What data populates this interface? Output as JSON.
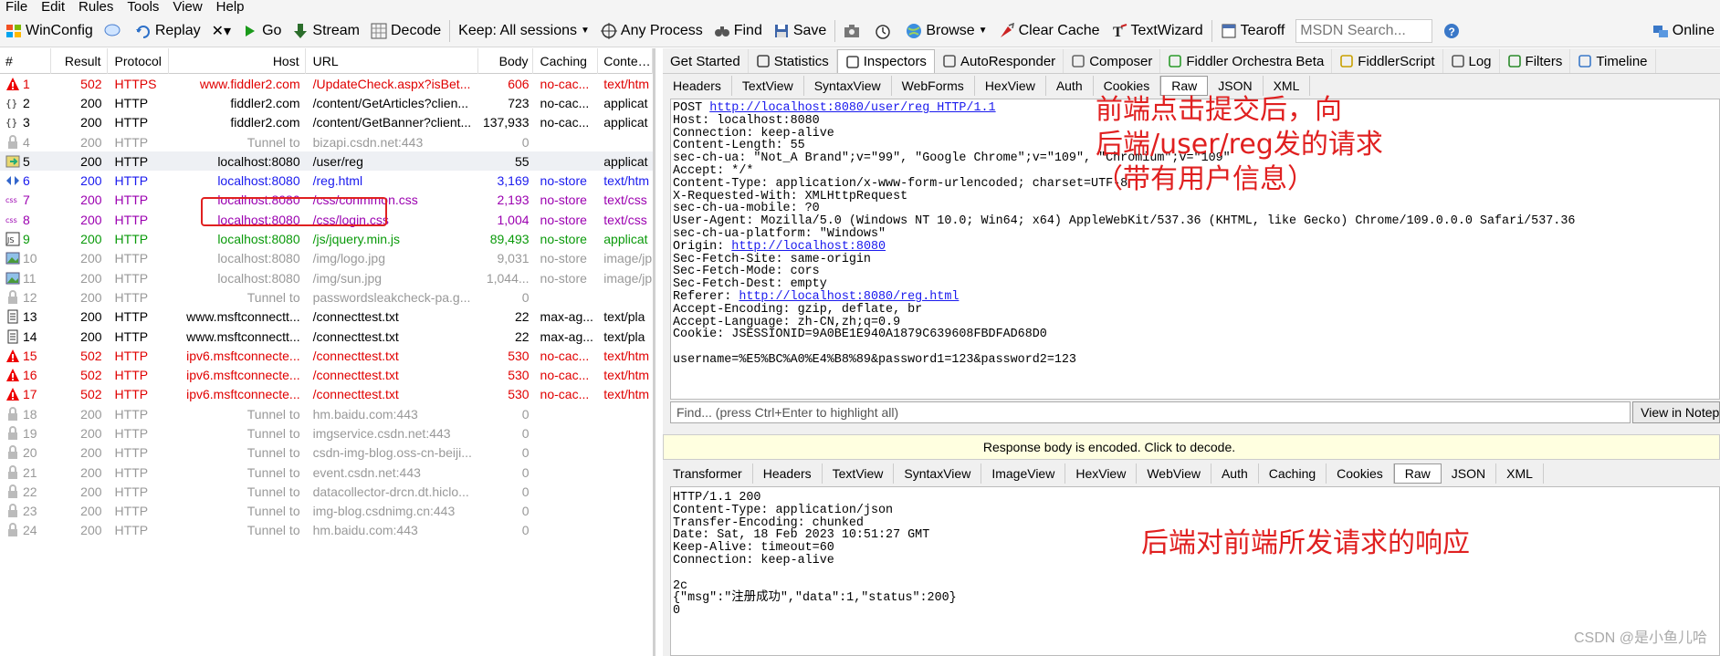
{
  "menu": [
    "File",
    "Edit",
    "Rules",
    "Tools",
    "View",
    "Help"
  ],
  "toolbar": {
    "winconfig": "WinConfig",
    "replay": "Replay",
    "remove": "✕▾",
    "go": "Go",
    "stream": "Stream",
    "decode": "Decode",
    "keep": "Keep: All sessions",
    "any_process": "Any Process",
    "find": "Find",
    "save": "Save",
    "browse": "Browse",
    "clear_cache": "Clear Cache",
    "textwizard": "TextWizard",
    "tearoff": "Tearoff",
    "msdn_placeholder": "MSDN Search...",
    "online": "Online"
  },
  "sessions": {
    "headers": [
      "#",
      "Result",
      "Protocol",
      "Host",
      "URL",
      "Body",
      "Caching",
      "Content-Type"
    ],
    "rows": [
      {
        "num": "1",
        "result": "502",
        "protocol": "HTTPS",
        "host": "www.fiddler2.com",
        "url": "/UpdateCheck.aspx?isBet...",
        "body": "606",
        "caching": "no-cac...",
        "ctype": "text/htm",
        "style": "red",
        "icon": "warn"
      },
      {
        "num": "2",
        "result": "200",
        "protocol": "HTTP",
        "host": "fiddler2.com",
        "url": "/content/GetArticles?clien...",
        "body": "723",
        "caching": "no-cac...",
        "ctype": "applicat",
        "style": "black",
        "icon": "json"
      },
      {
        "num": "3",
        "result": "200",
        "protocol": "HTTP",
        "host": "fiddler2.com",
        "url": "/content/GetBanner?client...",
        "body": "137,933",
        "caching": "no-cac...",
        "ctype": "applicat",
        "style": "black",
        "icon": "json"
      },
      {
        "num": "4",
        "result": "200",
        "protocol": "HTTP",
        "host": "Tunnel to",
        "url": "bizapi.csdn.net:443",
        "body": "0",
        "caching": "",
        "ctype": "",
        "style": "gray",
        "icon": "lock"
      },
      {
        "num": "5",
        "result": "200",
        "protocol": "HTTP",
        "host": "localhost:8080",
        "url": "/user/reg",
        "body": "55",
        "caching": "",
        "ctype": "applicat",
        "style": "black",
        "icon": "sel",
        "selected": true
      },
      {
        "num": "6",
        "result": "200",
        "protocol": "HTTP",
        "host": "localhost:8080",
        "url": "/reg.html",
        "body": "3,169",
        "caching": "no-store",
        "ctype": "text/htm",
        "style": "blue",
        "icon": "html"
      },
      {
        "num": "7",
        "result": "200",
        "protocol": "HTTP",
        "host": "localhost:8080",
        "url": "/css/conmmon.css",
        "body": "2,193",
        "caching": "no-store",
        "ctype": "text/css",
        "style": "purple",
        "icon": "css"
      },
      {
        "num": "8",
        "result": "200",
        "protocol": "HTTP",
        "host": "localhost:8080",
        "url": "/css/login.css",
        "body": "1,004",
        "caching": "no-store",
        "ctype": "text/css",
        "style": "purple",
        "icon": "css"
      },
      {
        "num": "9",
        "result": "200",
        "protocol": "HTTP",
        "host": "localhost:8080",
        "url": "/js/jquery.min.js",
        "body": "89,493",
        "caching": "no-store",
        "ctype": "applicat",
        "style": "green",
        "icon": "js"
      },
      {
        "num": "10",
        "result": "200",
        "protocol": "HTTP",
        "host": "localhost:8080",
        "url": "/img/logo.jpg",
        "body": "9,031",
        "caching": "no-store",
        "ctype": "image/jp",
        "style": "gray",
        "icon": "img"
      },
      {
        "num": "11",
        "result": "200",
        "protocol": "HTTP",
        "host": "localhost:8080",
        "url": "/img/sun.jpg",
        "body": "1,044...",
        "caching": "no-store",
        "ctype": "image/jp",
        "style": "gray",
        "icon": "img"
      },
      {
        "num": "12",
        "result": "200",
        "protocol": "HTTP",
        "host": "Tunnel to",
        "url": "passwordsleakcheck-pa.g...",
        "body": "0",
        "caching": "",
        "ctype": "",
        "style": "gray",
        "icon": "lock"
      },
      {
        "num": "13",
        "result": "200",
        "protocol": "HTTP",
        "host": "www.msftconnectt...",
        "url": "/connecttest.txt",
        "body": "22",
        "caching": "max-ag...",
        "ctype": "text/pla",
        "style": "black",
        "icon": "doc"
      },
      {
        "num": "14",
        "result": "200",
        "protocol": "HTTP",
        "host": "www.msftconnectt...",
        "url": "/connecttest.txt",
        "body": "22",
        "caching": "max-ag...",
        "ctype": "text/pla",
        "style": "black",
        "icon": "doc"
      },
      {
        "num": "15",
        "result": "502",
        "protocol": "HTTP",
        "host": "ipv6.msftconnecte...",
        "url": "/connecttest.txt",
        "body": "530",
        "caching": "no-cac...",
        "ctype": "text/htm",
        "style": "red",
        "icon": "warn"
      },
      {
        "num": "16",
        "result": "502",
        "protocol": "HTTP",
        "host": "ipv6.msftconnecte...",
        "url": "/connecttest.txt",
        "body": "530",
        "caching": "no-cac...",
        "ctype": "text/htm",
        "style": "red",
        "icon": "warn"
      },
      {
        "num": "17",
        "result": "502",
        "protocol": "HTTP",
        "host": "ipv6.msftconnecte...",
        "url": "/connecttest.txt",
        "body": "530",
        "caching": "no-cac...",
        "ctype": "text/htm",
        "style": "red",
        "icon": "warn"
      },
      {
        "num": "18",
        "result": "200",
        "protocol": "HTTP",
        "host": "Tunnel to",
        "url": "hm.baidu.com:443",
        "body": "0",
        "caching": "",
        "ctype": "",
        "style": "gray",
        "icon": "lock"
      },
      {
        "num": "19",
        "result": "200",
        "protocol": "HTTP",
        "host": "Tunnel to",
        "url": "imgservice.csdn.net:443",
        "body": "0",
        "caching": "",
        "ctype": "",
        "style": "gray",
        "icon": "lock"
      },
      {
        "num": "20",
        "result": "200",
        "protocol": "HTTP",
        "host": "Tunnel to",
        "url": "csdn-img-blog.oss-cn-beiji...",
        "body": "0",
        "caching": "",
        "ctype": "",
        "style": "gray",
        "icon": "lock"
      },
      {
        "num": "21",
        "result": "200",
        "protocol": "HTTP",
        "host": "Tunnel to",
        "url": "event.csdn.net:443",
        "body": "0",
        "caching": "",
        "ctype": "",
        "style": "gray",
        "icon": "lock"
      },
      {
        "num": "22",
        "result": "200",
        "protocol": "HTTP",
        "host": "Tunnel to",
        "url": "datacollector-drcn.dt.hiclo...",
        "body": "0",
        "caching": "",
        "ctype": "",
        "style": "gray",
        "icon": "lock"
      },
      {
        "num": "23",
        "result": "200",
        "protocol": "HTTP",
        "host": "Tunnel to",
        "url": "img-blog.csdnimg.cn:443",
        "body": "0",
        "caching": "",
        "ctype": "",
        "style": "gray",
        "icon": "lock"
      },
      {
        "num": "24",
        "result": "200",
        "protocol": "HTTP",
        "host": "Tunnel to",
        "url": "hm.baidu.com:443",
        "body": "0",
        "caching": "",
        "ctype": "",
        "style": "gray",
        "icon": "lock"
      }
    ]
  },
  "main_tabs": [
    "Get Started",
    "Statistics",
    "Inspectors",
    "AutoResponder",
    "Composer",
    "Fiddler Orchestra Beta",
    "FiddlerScript",
    "Log",
    "Filters",
    "Timeline"
  ],
  "request_tabs": [
    "Headers",
    "TextView",
    "SyntaxView",
    "WebForms",
    "HexView",
    "Auth",
    "Cookies",
    "Raw",
    "JSON",
    "XML"
  ],
  "request": {
    "method": "POST ",
    "url": "http://localhost:8080/user/reg HTTP/1.1",
    "lines": [
      "Host: localhost:8080",
      "Connection: keep-alive",
      "Content-Length: 55",
      "sec-ch-ua: \"Not_A Brand\";v=\"99\", \"Google Chrome\";v=\"109\", \"Chromium\";v=\"109\"",
      "Accept: */*",
      "Content-Type: application/x-www-form-urlencoded; charset=UTF-8",
      "X-Requested-With: XMLHttpRequest",
      "sec-ch-ua-mobile: ?0",
      "User-Agent: Mozilla/5.0 (Windows NT 10.0; Win64; x64) AppleWebKit/537.36 (KHTML, like Gecko) Chrome/109.0.0.0 Safari/537.36",
      "sec-ch-ua-platform: \"Windows\""
    ],
    "origin_label": "Origin: ",
    "origin_url": "http://localhost:8080",
    "lines2": [
      "Sec-Fetch-Site: same-origin",
      "Sec-Fetch-Mode: cors",
      "Sec-Fetch-Dest: empty"
    ],
    "referer_label": "Referer: ",
    "referer_url": "http://localhost:8080/reg.html",
    "lines3": [
      "Accept-Encoding: gzip, deflate, br",
      "Accept-Language: zh-CN,zh;q=0.9",
      "Cookie: JSESSIONID=9A0BE1E940A1879C639608FBDFAD68D0",
      "",
      "username=%E5%BC%A0%E4%B8%89&password1=123&password2=123"
    ]
  },
  "find": {
    "placeholder": "Find... (press Ctrl+Enter to highlight all)",
    "button": "View in Notepad"
  },
  "encoded_notice": "Response body is encoded. Click to decode.",
  "response_tabs": [
    "Transformer",
    "Headers",
    "TextView",
    "SyntaxView",
    "ImageView",
    "HexView",
    "WebView",
    "Auth",
    "Caching",
    "Cookies",
    "Raw",
    "JSON",
    "XML"
  ],
  "response": {
    "text": "HTTP/1.1 200\nContent-Type: application/json\nTransfer-Encoding: chunked\nDate: Sat, 18 Feb 2023 10:51:27 GMT\nKeep-Alive: timeout=60\nConnection: keep-alive\n\n2c\n{\"msg\":\"注册成功\",\"data\":1,\"status\":200}\n0"
  },
  "annotations": {
    "request_note_1": "前端点击提交后，向",
    "request_note_2": "后端/user/reg发的请求",
    "request_note_3": "（带有用户信息）",
    "response_note": "后端对前端所发请求的响应"
  },
  "watermark": "CSDN @是小鱼儿哈"
}
